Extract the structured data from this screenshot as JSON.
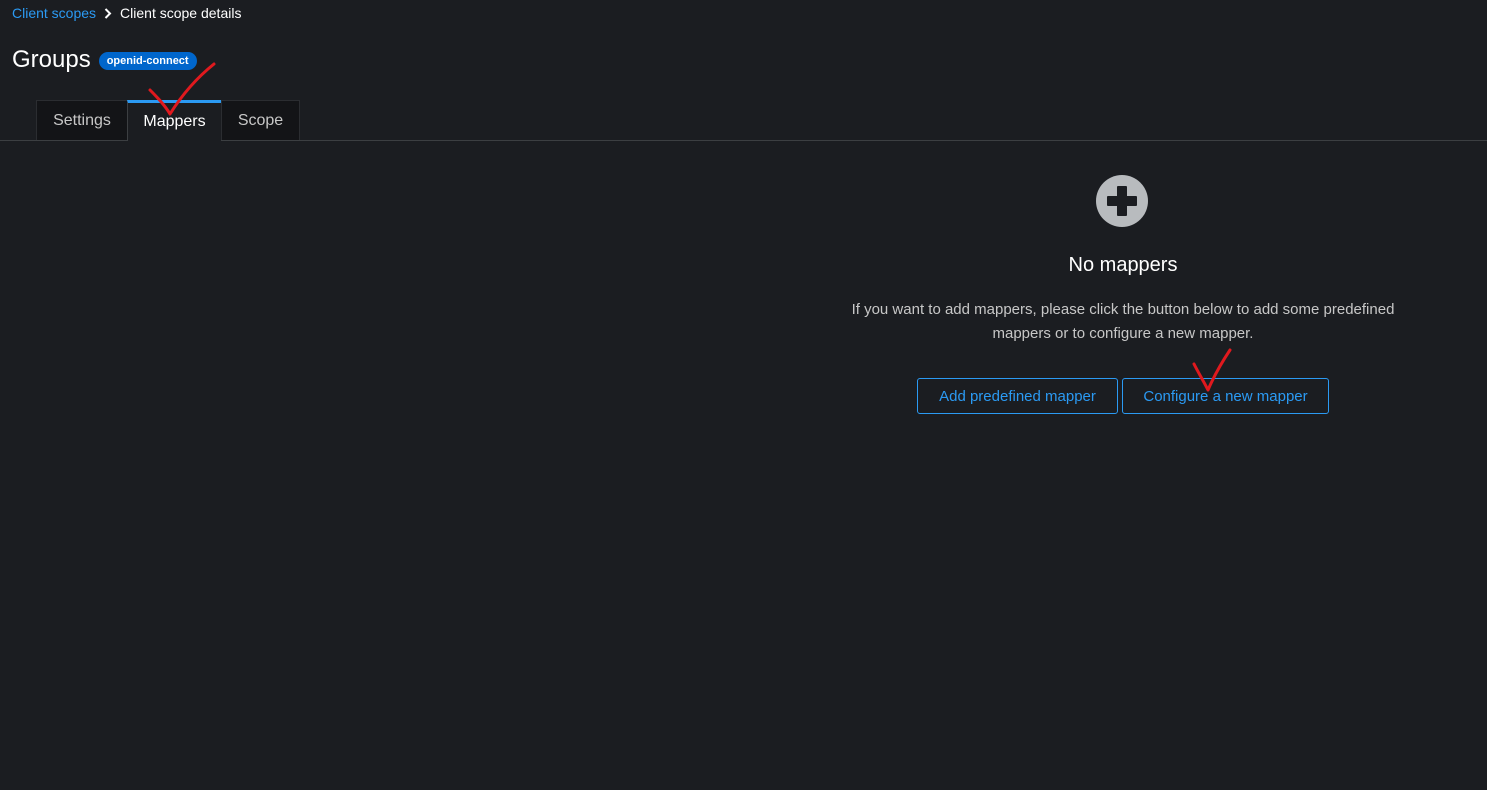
{
  "breadcrumb": {
    "parent": "Client scopes",
    "current": "Client scope details"
  },
  "header": {
    "title": "Groups",
    "badge": "openid-connect"
  },
  "tabs": [
    {
      "label": "Settings",
      "active": false
    },
    {
      "label": "Mappers",
      "active": true
    },
    {
      "label": "Scope",
      "active": false
    }
  ],
  "empty_state": {
    "icon": "plus-circle-icon",
    "title": "No mappers",
    "body_line1": "If you want to add mappers, please click the button below to add some predefined",
    "body_line2": "mappers or to configure a new mapper.",
    "add_predefined_label": "Add predefined mapper",
    "configure_label": "Configure a new mapper"
  },
  "colors": {
    "background": "#1b1d21",
    "accent": "#2b9af3",
    "badge": "#0066cc",
    "annotation": "#e0191e"
  }
}
